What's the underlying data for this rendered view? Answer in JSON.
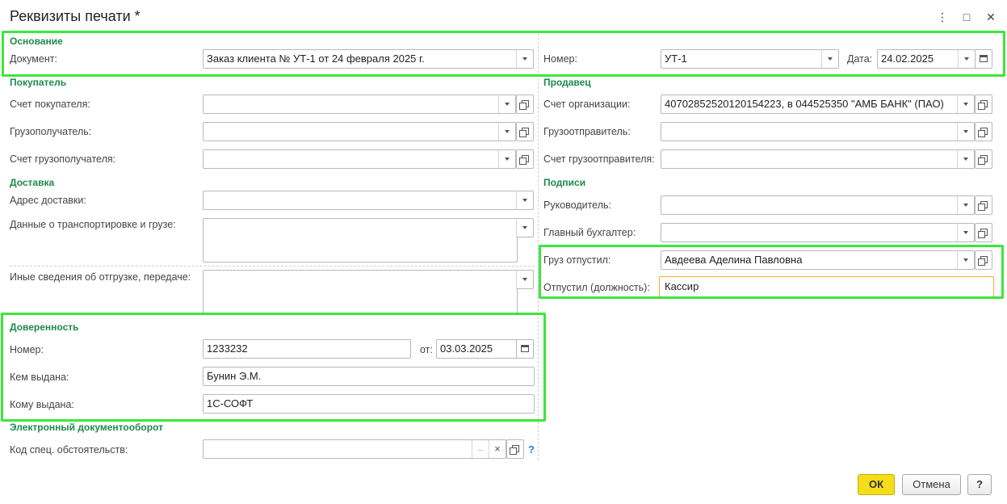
{
  "window": {
    "title": "Реквизиты печати *",
    "more_icon": "⋮",
    "maximize_icon": "□",
    "close_icon": "✕"
  },
  "osnovanie": {
    "header": "Основание",
    "document_label": "Документ:",
    "document_value": "Заказ клиента № УТ-1 от 24 февраля 2025 г.",
    "number_label": "Номер:",
    "number_value": "УТ-1",
    "date_label": "Дата:",
    "date_value": "24.02.2025"
  },
  "buyer": {
    "header": "Покупатель",
    "account_label": "Счет покупателя:",
    "account_value": "",
    "consignee_label": "Грузополучатель:",
    "consignee_value": "",
    "consignee_account_label": "Счет грузополучателя:",
    "consignee_account_value": ""
  },
  "seller": {
    "header": "Продавец",
    "account_label": "Счет организации:",
    "account_value": "40702852520120154223, в 044525350 \"АМБ БАНК\" (ПАО)",
    "shipper_label": "Грузоотправитель:",
    "shipper_value": "",
    "shipper_account_label": "Счет грузоотправителя:",
    "shipper_account_value": ""
  },
  "delivery": {
    "header": "Доставка",
    "address_label": "Адрес доставки:",
    "address_value": "",
    "transport_label": "Данные о транспортировке и грузе:",
    "transport_value": "",
    "other_label": "Иные сведения об отгрузке, передаче:",
    "other_value": ""
  },
  "signatures": {
    "header": "Подписи",
    "director_label": "Руководитель:",
    "director_value": "",
    "accountant_label": "Главный бухгалтер:",
    "accountant_value": "",
    "released_by_label": "Груз отпустил:",
    "released_by_value": "Авдеева Аделина Павловна",
    "released_position_label": "Отпустил (должность):",
    "released_position_value": "Кассир"
  },
  "proxy": {
    "header": "Доверенность",
    "number_label": "Номер:",
    "number_value": "1233232",
    "date_label": "от:",
    "date_value": "03.03.2025",
    "issued_by_label": "Кем выдана:",
    "issued_by_value": "Бунин Э.М.",
    "issued_to_label": "Кому выдана:",
    "issued_to_value": "1С-СОФТ"
  },
  "edo": {
    "header": "Электронный документооборот",
    "code_label": "Код спец. обстоятельств:",
    "code_value": "",
    "select_button": "...",
    "clear_button": "×",
    "help": "?"
  },
  "footer": {
    "ok": "ОК",
    "cancel": "Отмена",
    "help": "?"
  }
}
